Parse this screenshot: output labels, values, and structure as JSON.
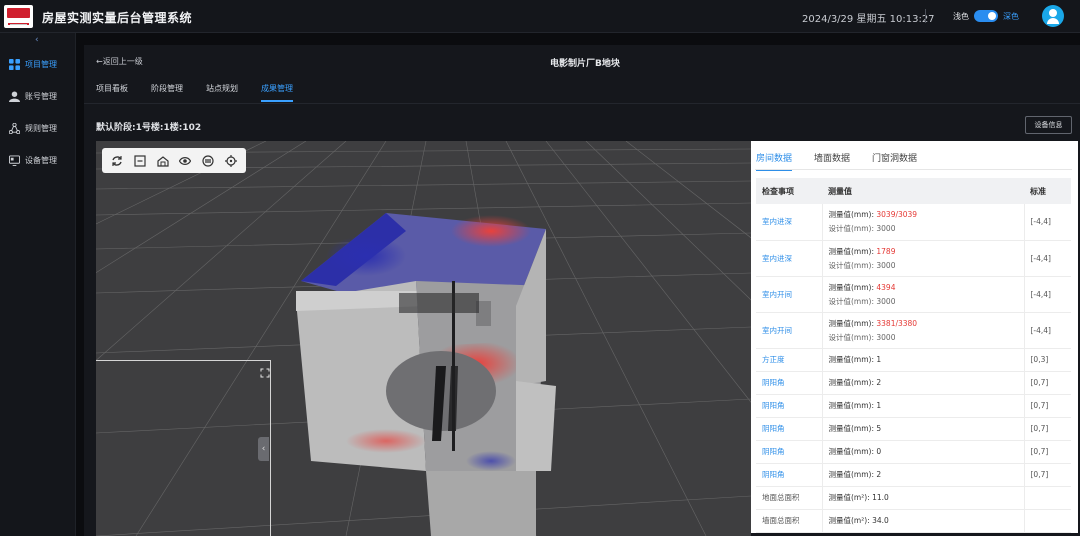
{
  "header": {
    "app_title": "房屋实测实量后台管理系统",
    "datetime": "2024/3/29  星期五  10:13:27",
    "theme_light": "浅色",
    "theme_dark": "深色",
    "accent": "#3aa0ff"
  },
  "sidebar": {
    "collapse": "‹",
    "items": [
      {
        "label": "项目管理",
        "icon": "grid-icon",
        "active": true
      },
      {
        "label": "账号管理",
        "icon": "user-icon",
        "active": false
      },
      {
        "label": "规则管理",
        "icon": "nodes-icon",
        "active": false
      },
      {
        "label": "设备管理",
        "icon": "monitor-icon",
        "active": false
      }
    ]
  },
  "main": {
    "back": "←返回上一级",
    "title": "电影制片厂B地块",
    "tabs": [
      "项目看板",
      "阶段管理",
      "站点规划",
      "成果管理"
    ],
    "active_tab": "成果管理",
    "stage_label": "默认阶段:1号楼:1楼:102",
    "device_button": "设备信息"
  },
  "viewer": {
    "tools": [
      "refresh-icon",
      "minus-box-icon",
      "home-3d-icon",
      "eye-icon",
      "layers-icon",
      "target-icon"
    ],
    "drawer_handle": "‹"
  },
  "panel": {
    "tabs": [
      "房间数据",
      "墙面数据",
      "门窗洞数据"
    ],
    "active_tab": "房间数据",
    "columns": [
      "检查事项",
      "测量值",
      "标准"
    ],
    "rows": [
      {
        "item": "室内进深",
        "link": true,
        "measured_label": "测量值(mm): ",
        "measured_value": "3039/3039",
        "red": true,
        "design": "设计值(mm): 3000",
        "standard": "[-4,4]"
      },
      {
        "item": "室内进深",
        "link": true,
        "measured_label": "测量值(mm): ",
        "measured_value": "1789",
        "red": true,
        "design": "设计值(mm): 3000",
        "standard": "[-4,4]"
      },
      {
        "item": "室内开间",
        "link": true,
        "measured_label": "测量值(mm): ",
        "measured_value": "4394",
        "red": true,
        "design": "设计值(mm): 3000",
        "standard": "[-4,4]"
      },
      {
        "item": "室内开间",
        "link": true,
        "measured_label": "测量值(mm): ",
        "measured_value": "3381/3380",
        "red": true,
        "design": "设计值(mm): 3000",
        "standard": "[-4,4]"
      },
      {
        "item": "方正度",
        "link": true,
        "measured_label": "测量值(mm): ",
        "measured_value": "1",
        "red": false,
        "design": "",
        "standard": "[0,3]"
      },
      {
        "item": "阴阳角",
        "link": true,
        "measured_label": "测量值(mm): ",
        "measured_value": "2",
        "red": false,
        "design": "",
        "standard": "[0,7]"
      },
      {
        "item": "阴阳角",
        "link": true,
        "measured_label": "测量值(mm): ",
        "measured_value": "1",
        "red": false,
        "design": "",
        "standard": "[0,7]"
      },
      {
        "item": "阴阳角",
        "link": true,
        "measured_label": "测量值(mm): ",
        "measured_value": "5",
        "red": false,
        "design": "",
        "standard": "[0,7]"
      },
      {
        "item": "阴阳角",
        "link": true,
        "measured_label": "测量值(mm): ",
        "measured_value": "0",
        "red": false,
        "design": "",
        "standard": "[0,7]"
      },
      {
        "item": "阴阳角",
        "link": true,
        "measured_label": "测量值(mm): ",
        "measured_value": "2",
        "red": false,
        "design": "",
        "standard": "[0,7]"
      },
      {
        "item": "地面总面积",
        "link": false,
        "measured_label": "测量值(m²): ",
        "measured_value": "11.0",
        "red": false,
        "design": "",
        "standard": ""
      },
      {
        "item": "墙面总面积",
        "link": false,
        "measured_label": "测量值(m²): ",
        "measured_value": "34.0",
        "red": false,
        "design": "",
        "standard": ""
      }
    ]
  }
}
